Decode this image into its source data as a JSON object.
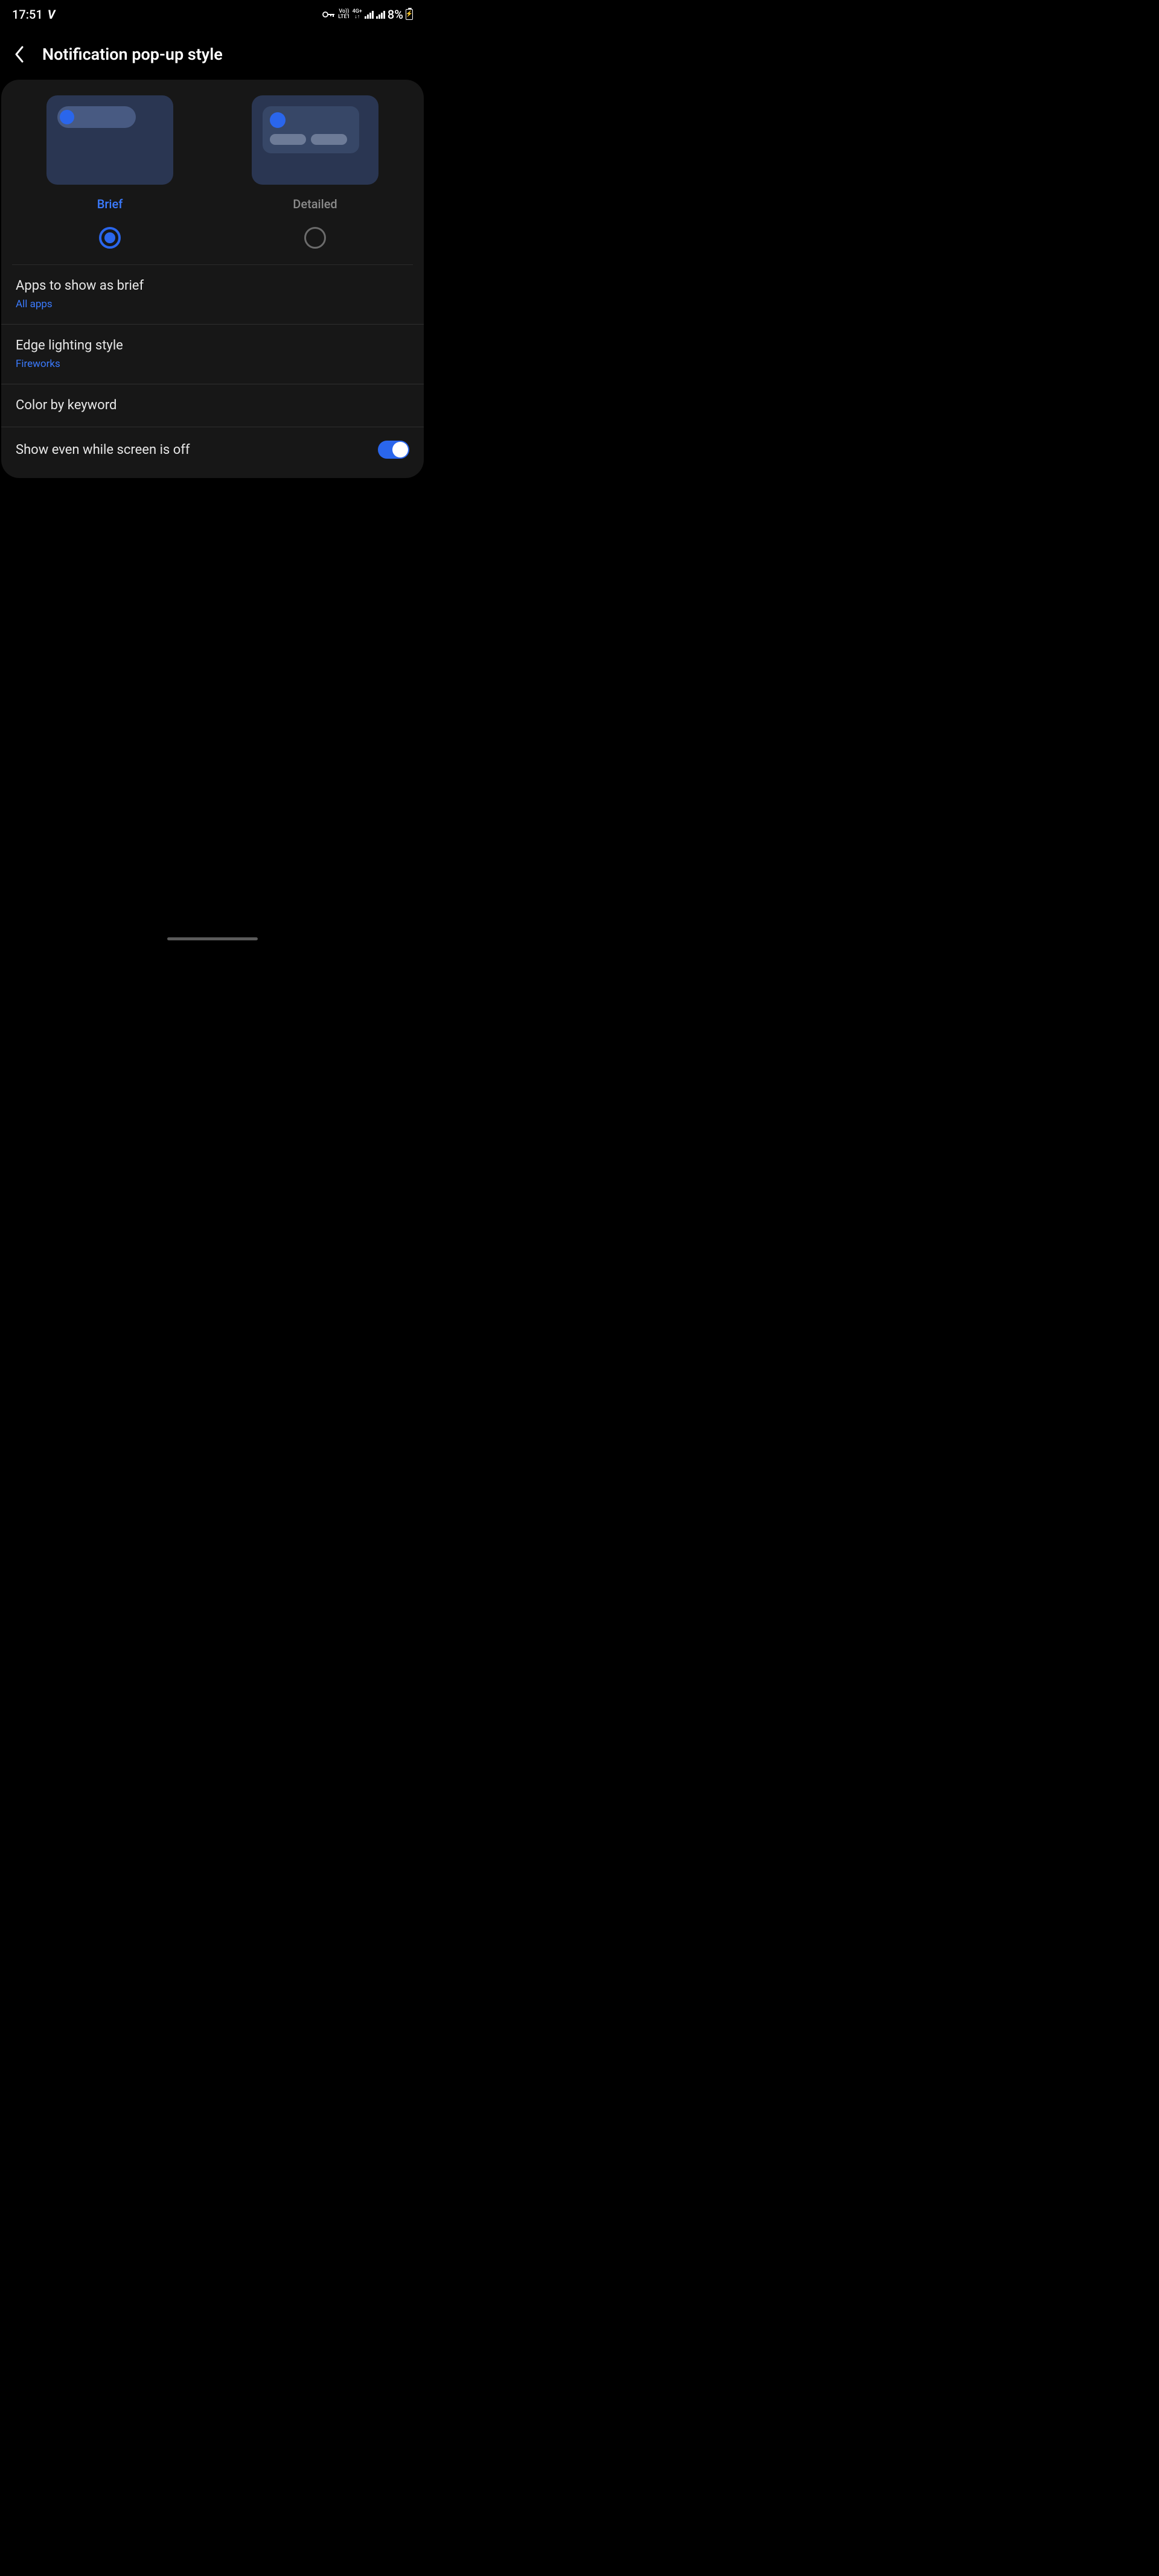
{
  "status": {
    "time": "17:51",
    "lte_top": "Vo))",
    "lte_bottom": "LTE1",
    "net": "4G+",
    "arrows": "↓↑",
    "battery_pct": "8%"
  },
  "header": {
    "title": "Notification pop-up style"
  },
  "styles": {
    "brief": {
      "label": "Brief",
      "selected": true
    },
    "detailed": {
      "label": "Detailed",
      "selected": false
    }
  },
  "rows": {
    "apps": {
      "title": "Apps to show as brief",
      "value": "All apps"
    },
    "edge": {
      "title": "Edge lighting style",
      "value": "Fireworks"
    },
    "color": {
      "title": "Color by keyword"
    },
    "show_off": {
      "title": "Show even while screen is off",
      "toggle": true
    }
  }
}
